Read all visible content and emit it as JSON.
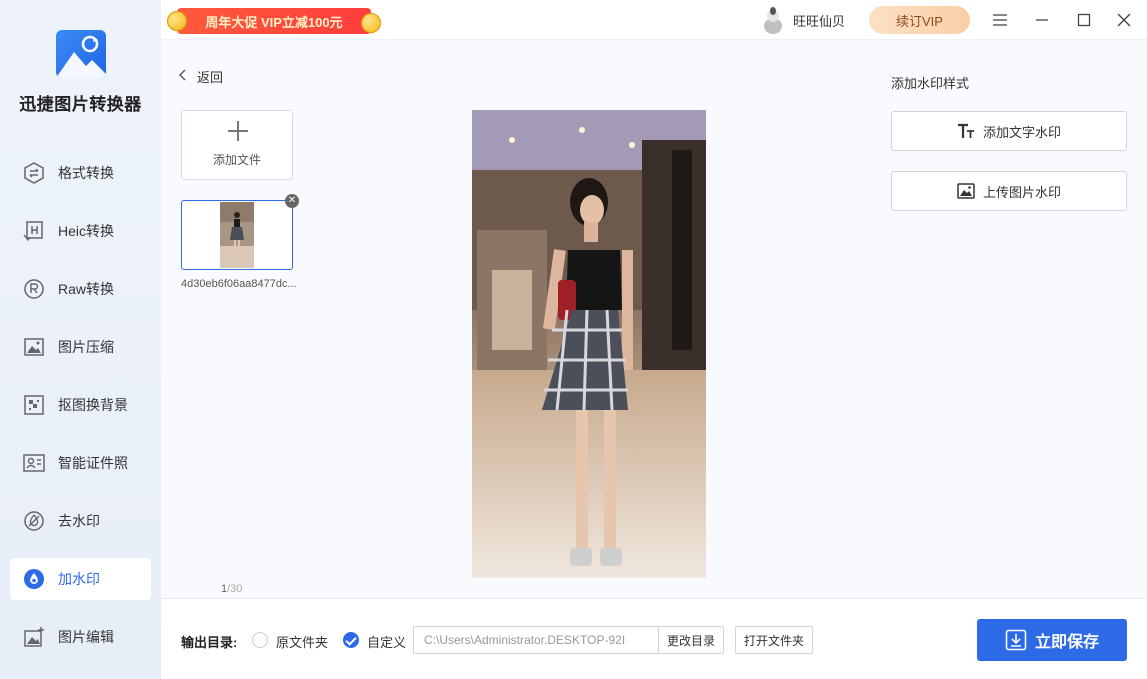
{
  "app": {
    "name": "迅捷图片转换器",
    "promo_text": "周年大促 VIP立减100元",
    "username": "旺旺仙贝",
    "vip_label": "续订VIP"
  },
  "sidebar": {
    "items": [
      {
        "label": "格式转换",
        "icon": "format-convert-icon",
        "active": false
      },
      {
        "label": "Heic转换",
        "icon": "heic-icon",
        "active": false
      },
      {
        "label": "Raw转换",
        "icon": "raw-icon",
        "active": false
      },
      {
        "label": "图片压缩",
        "icon": "compress-icon",
        "active": false
      },
      {
        "label": "抠图换背景",
        "icon": "cutout-icon",
        "active": false
      },
      {
        "label": "智能证件照",
        "icon": "id-photo-icon",
        "active": false
      },
      {
        "label": "去水印",
        "icon": "remove-watermark-icon",
        "active": false
      },
      {
        "label": "加水印",
        "icon": "add-watermark-icon",
        "active": true
      },
      {
        "label": "图片编辑",
        "icon": "image-edit-icon",
        "active": false
      }
    ]
  },
  "main": {
    "back_label": "返回",
    "add_file_label": "添加文件",
    "file_name": "4d30eb6f06aa8477dc...",
    "page_current": "1",
    "page_total": "/30",
    "watermark_title": "添加水印样式",
    "add_text_watermark": "添加文字水印",
    "upload_image_watermark": "上传图片水印"
  },
  "bottom": {
    "output_label": "输出目录:",
    "option_original": "原文件夹",
    "option_custom": "自定义",
    "path_value": "C:\\Users\\Administrator.DESKTOP-92I",
    "change_dir": "更改目录",
    "open_folder": "打开文件夹",
    "save_now": "立即保存"
  },
  "colors": {
    "accent": "#2d6ae6",
    "promo": "#ff4a3c",
    "vip": "#f8cfa6"
  }
}
